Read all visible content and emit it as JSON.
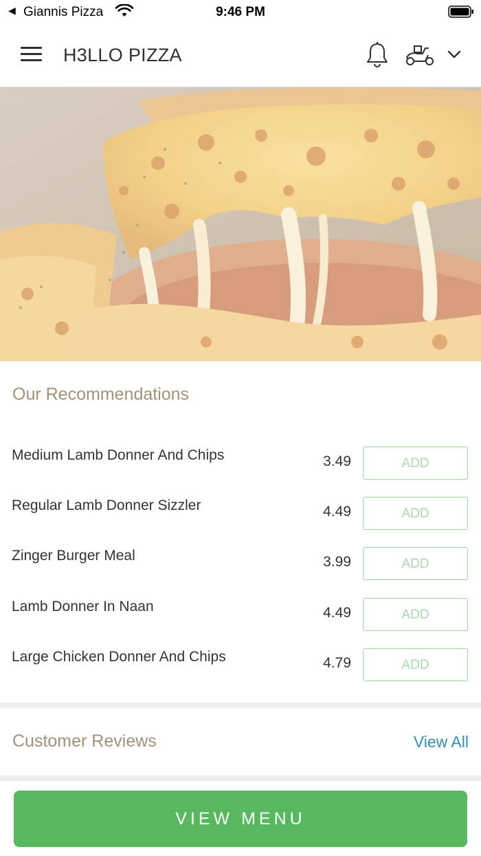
{
  "status_bar": {
    "back_glyph": "◀",
    "carrier": "Giannis Pizza",
    "time": "9:46 PM",
    "wifi_icon": "wifi-icon",
    "battery_icon": "battery-icon"
  },
  "header": {
    "title": "H3LLO PIZZA",
    "menu_icon": "hamburger-menu-icon",
    "notification_icon": "bell-icon",
    "delivery_icon": "scooter-icon",
    "dropdown_icon": "chevron-down-icon"
  },
  "hero": {
    "image_subject": "cheese pizza slice"
  },
  "recommendations": {
    "title": "Our Recommendations",
    "items": [
      {
        "name": "Medium Lamb Donner And Chips",
        "price": "3.49",
        "add_label": "ADD"
      },
      {
        "name": "Regular Lamb Donner Sizzler",
        "price": "4.49",
        "add_label": "ADD"
      },
      {
        "name": "Zinger Burger Meal",
        "price": "3.99",
        "add_label": "ADD"
      },
      {
        "name": "Lamb Donner In Naan",
        "price": "4.49",
        "add_label": "ADD"
      },
      {
        "name": "Large Chicken Donner And Chips",
        "price": "4.79",
        "add_label": "ADD"
      }
    ]
  },
  "reviews": {
    "title": "Customer Reviews",
    "view_all": "View All"
  },
  "footer": {
    "view_menu": "VIEW MENU"
  },
  "colors": {
    "accent_green": "#57b85f",
    "section_title": "#a39276",
    "link_blue": "#2f8fc0"
  }
}
